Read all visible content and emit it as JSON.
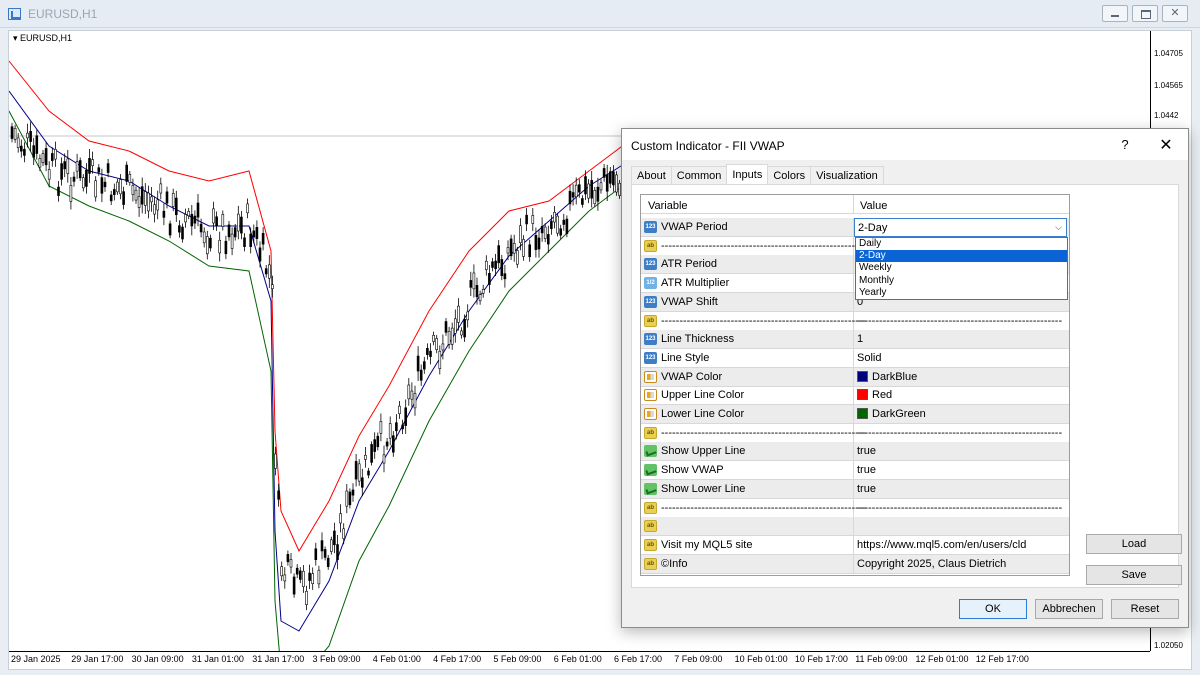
{
  "window": {
    "title": "EURUSD,H1",
    "close_glyph": "✕"
  },
  "chart": {
    "symbol_label": "EURUSD,H1",
    "price_labels": [
      "1.04705",
      "1.04565",
      "1.0442",
      "1.02050"
    ],
    "time_labels": [
      "29 Jan 2025",
      "29 Jan 17:00",
      "30 Jan 09:00",
      "31 Jan 01:00",
      "31 Jan 17:00",
      "3 Feb 09:00",
      "4 Feb 01:00",
      "4 Feb 17:00",
      "5 Feb 09:00",
      "6 Feb 01:00",
      "6 Feb 17:00",
      "7 Feb 09:00",
      "10 Feb 01:00",
      "10 Feb 17:00",
      "11 Feb 09:00",
      "12 Feb 01:00",
      "12 Feb 17:00"
    ],
    "colors": {
      "vwap": "#00008b",
      "upper": "#ff0000",
      "lower": "#006400",
      "candles": "#000000"
    }
  },
  "dialog": {
    "title": "Custom Indicator - FII VWAP",
    "help_glyph": "?",
    "close_glyph": "✕",
    "tabs": [
      "About",
      "Common",
      "Inputs",
      "Colors",
      "Visualization"
    ],
    "active_tab": "Inputs",
    "headers": {
      "variable": "Variable",
      "value": "Value"
    },
    "rows": [
      {
        "icon": "int",
        "name": "VWAP Period",
        "value": "2-Day"
      },
      {
        "icon": "str",
        "name": "--------------------------------------------------------",
        "value": ""
      },
      {
        "icon": "int",
        "name": "ATR Period",
        "value": ""
      },
      {
        "icon": "dbl",
        "name": "ATR Multiplier",
        "value": ""
      },
      {
        "icon": "int",
        "name": "VWAP Shift",
        "value": "0"
      },
      {
        "icon": "str",
        "name": "--------------------------------------------------------",
        "value": "--------------------------------------------------------"
      },
      {
        "icon": "int",
        "name": "Line Thickness",
        "value": "1"
      },
      {
        "icon": "int",
        "name": "Line Style",
        "value": "Solid"
      },
      {
        "icon": "col",
        "name": "VWAP Color",
        "value": "DarkBlue",
        "swatch": "#00007f"
      },
      {
        "icon": "col",
        "name": "Upper Line Color",
        "value": "Red",
        "swatch": "#ff0000"
      },
      {
        "icon": "col",
        "name": "Lower Line Color",
        "value": "DarkGreen",
        "swatch": "#006400"
      },
      {
        "icon": "str",
        "name": "--------------------------------------------------------",
        "value": "--------------------------------------------------------"
      },
      {
        "icon": "bool",
        "name": "Show Upper Line",
        "value": "true"
      },
      {
        "icon": "bool",
        "name": "Show VWAP",
        "value": "true"
      },
      {
        "icon": "bool",
        "name": "Show Lower Line",
        "value": "true"
      },
      {
        "icon": "str",
        "name": "--------------------------------------------------------",
        "value": "--------------------------------------------------------"
      },
      {
        "icon": "str",
        "name": "",
        "value": ""
      },
      {
        "icon": "str",
        "name": "Visit my MQL5 site",
        "value": "https://www.mql5.com/en/users/cld"
      },
      {
        "icon": "str",
        "name": "©Info",
        "value": "Copyright 2025, Claus Dietrich"
      }
    ],
    "icon_text": {
      "int": "123",
      "dbl": "1/2",
      "str": "ab"
    },
    "dropdown": {
      "options": [
        "Daily",
        "2-Day",
        "Weekly",
        "Monthly",
        "Yearly"
      ],
      "selected": "2-Day"
    },
    "buttons": {
      "load": "Load",
      "save": "Save",
      "ok": "OK",
      "cancel": "Abbrechen",
      "reset": "Reset"
    }
  }
}
